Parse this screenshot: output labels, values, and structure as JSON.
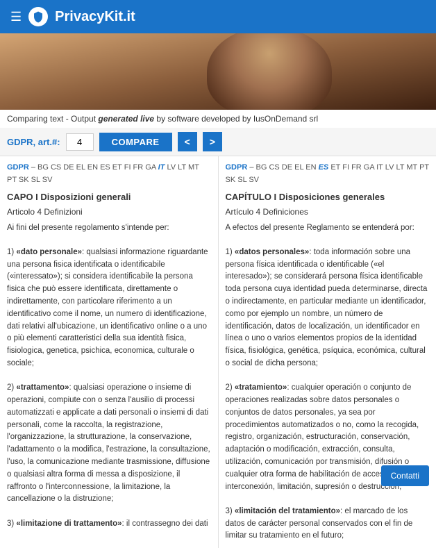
{
  "header": {
    "title": "PrivacyKit.it",
    "menu_icon": "☰",
    "logo_icon": "shield"
  },
  "subheader": {
    "prefix": "Comparing text - Output ",
    "bold_text": "generated live",
    "suffix": " by software developed by IusOnDemand srl"
  },
  "controls": {
    "label": "GDPR, art.#:",
    "input_value": "4",
    "compare_label": "COMPARE",
    "prev_label": "<",
    "next_label": ">"
  },
  "left_column": {
    "gdpr_link": "GDPR",
    "langs": "BG CS DE EL EN ES ET FI FR GA IT LV LT MT PT SK SL SV",
    "active_lang": "IT",
    "chapter": "CAPO I Disposizioni generali",
    "article": "Articolo 4 Definizioni",
    "intro": "Ai fini del presente regolamento s'intende per:",
    "items": [
      {
        "number": "1)",
        "term": "«dato personale»",
        "rest": ": qualsiasi informazione riguardante una persona fisica identificata o identificabile («interessato»); si considera identificabile la persona fisica che può essere identificata, direttamente o indirettamente, con particolare riferimento a un identificativo come il nome, un numero di identificazione, dati relativi all'ubicazione, un identificativo online o a uno o più elementi caratteristici della sua identità fisica, fisiologica, genetica, psichica, economica, culturale o sociale;"
      },
      {
        "number": "2)",
        "term": "«trattamento»",
        "rest": ": qualsiasi operazione o insieme di operazioni, compiute con o senza l'ausilio di processi automatizzati e applicate a dati personali o insiemi di dati personali, come la raccolta, la registrazione, l'organizzazione, la strutturazione, la conservazione, l'adattamento o la modifica, l'estrazione, la consultazione, l'uso, la comunicazione mediante trasmissione, diffusione o qualsiasi altra forma di messa a disposizione, il raffronto o l'interconnessione, la limitazione, la cancellazione o la distruzione;"
      },
      {
        "number": "3)",
        "term": "«limitazione di trattamento»",
        "rest": ": il contrassegno dei dati"
      }
    ]
  },
  "right_column": {
    "gdpr_link": "GDPR",
    "langs": "BG CS DE EL EN ES ET FI FR GA IT LV LT MT PT SK SL SV",
    "active_lang": "ES",
    "chapter": "CAPÍTULO I Disposiciones generales",
    "article": "Artículo 4 Definiciones",
    "intro": "A efectos del presente Reglamento se entenderá por:",
    "items": [
      {
        "number": "1)",
        "term": "«datos personales»",
        "rest": ": toda información sobre una persona física identificada o identificable («el interesado»); se considerará persona física identificable toda persona cuya identidad pueda determinarse, directa o indirectamente, en particular mediante un identificador, como por ejemplo un nombre, un número de identificación, datos de localización, un identificador en línea o uno o varios elementos propios de la identidad física, fisiológica, genética, psíquica, económica, cultural o social de dicha persona;"
      },
      {
        "number": "2)",
        "term": "«tratamiento»",
        "rest": ": cualquier operación o conjunto de operaciones realizadas sobre datos personales o conjuntos de datos personales, ya sea por procedimientos automatizados o no, como la recogida, registro, organización, estructuración, conservación, adaptación o modificación, extracción, consulta, utilización, comunicación por transmisión, difusión o cualquier otra forma de habilitación de acceso, cotejo o interconexión, limitación, supresión o destrucción;"
      },
      {
        "number": "3)",
        "term": "«limitación del tratamiento»",
        "rest": ": el marcado de los datos de carácter personal conservados con el fin de limitar su tratamiento en el futuro;"
      }
    ]
  },
  "contact_button": {
    "label": "Contatti"
  }
}
